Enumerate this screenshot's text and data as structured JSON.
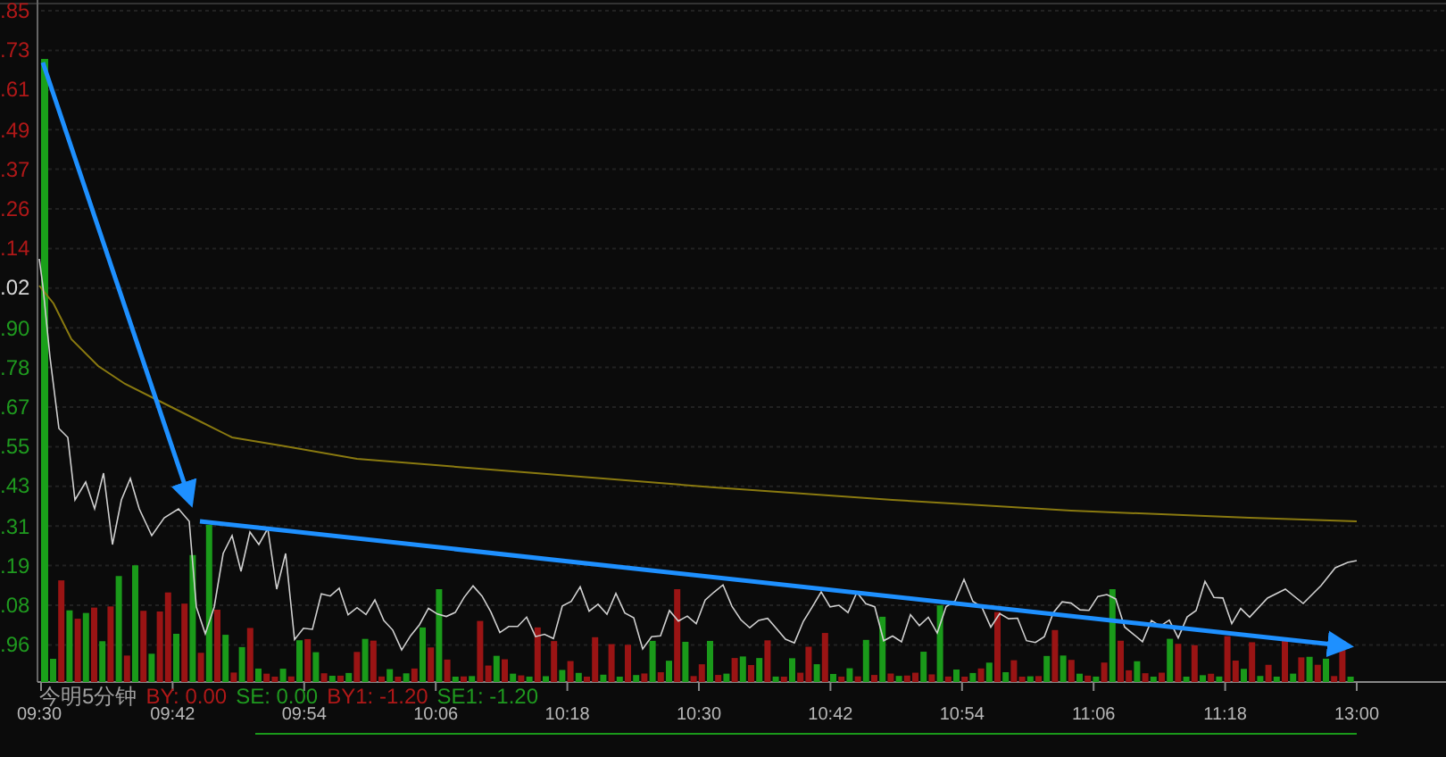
{
  "price_axis": [
    {
      "label": ".85",
      "kind": "up"
    },
    {
      "label": ".73",
      "kind": "up"
    },
    {
      "label": ".61",
      "kind": "up"
    },
    {
      "label": ".49",
      "kind": "up"
    },
    {
      "label": ".37",
      "kind": "up"
    },
    {
      "label": ".26",
      "kind": "up"
    },
    {
      "label": ".14",
      "kind": "up"
    },
    {
      "label": ".02",
      "kind": "flat"
    },
    {
      "label": ".90",
      "kind": "down"
    },
    {
      "label": ".78",
      "kind": "down"
    },
    {
      "label": ".67",
      "kind": "down"
    },
    {
      "label": ".55",
      "kind": "down"
    },
    {
      "label": ".43",
      "kind": "down"
    },
    {
      "label": ".31",
      "kind": "down"
    },
    {
      "label": ".19",
      "kind": "down"
    },
    {
      "label": ".08",
      "kind": "down"
    },
    {
      "label": ".96",
      "kind": "down"
    }
  ],
  "legend": [
    {
      "text": "今明5分钟",
      "kind": "title"
    },
    {
      "text": "BY: 0.00",
      "kind": "up"
    },
    {
      "text": "SE: 0.00",
      "kind": "down"
    },
    {
      "text": "BY1: -1.20",
      "kind": "up"
    },
    {
      "text": "SE1: -1.20",
      "kind": "down"
    }
  ],
  "time_axis": [
    "09:30",
    "09:42",
    "09:54",
    "10:06",
    "10:18",
    "10:30",
    "10:42",
    "10:54",
    "11:06",
    "11:18",
    "13:00"
  ]
}
